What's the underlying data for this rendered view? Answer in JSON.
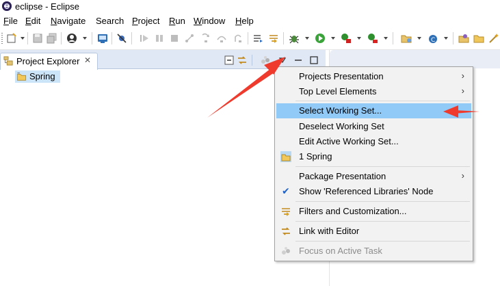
{
  "window": {
    "title": "eclipse - Eclipse"
  },
  "menubar": {
    "items": [
      {
        "label": "File",
        "mnemonic": "F",
        "rest": "ile"
      },
      {
        "label": "Edit",
        "mnemonic": "E",
        "rest": "dit"
      },
      {
        "label": "Navigate",
        "mnemonic": "N",
        "rest": "avigate"
      },
      {
        "label": "Search",
        "mnemonic": "",
        "rest": "Search"
      },
      {
        "label": "Project",
        "mnemonic": "P",
        "rest": "roject"
      },
      {
        "label": "Run",
        "mnemonic": "R",
        "rest": "un"
      },
      {
        "label": "Window",
        "mnemonic": "W",
        "rest": "indow"
      },
      {
        "label": "Help",
        "mnemonic": "H",
        "rest": "elp"
      }
    ]
  },
  "view": {
    "tab_label": "Project Explorer",
    "tab_close": "✕",
    "tree": [
      {
        "label": "Spring",
        "icon": "project-folder-icon"
      }
    ]
  },
  "menu": {
    "items": [
      {
        "label": "Projects Presentation",
        "submenu": true
      },
      {
        "label": "Top Level Elements",
        "submenu": true
      },
      {
        "label": "Select Working Set...",
        "selected": true
      },
      {
        "label": "Deselect Working Set"
      },
      {
        "label": "Edit Active Working Set..."
      },
      {
        "label": "1 Spring",
        "icon": "working-set-icon"
      },
      {
        "label": "Package Presentation",
        "submenu": true
      },
      {
        "label": "Show 'Referenced Libraries' Node",
        "checked": true
      },
      {
        "label": "Filters and Customization...",
        "icon": "filter-icon"
      },
      {
        "label": "Link with Editor",
        "icon": "link-editor-icon"
      },
      {
        "label": "Focus on Active Task",
        "icon": "focus-task-icon",
        "disabled": true
      }
    ],
    "submenu_arrow": "›",
    "check_mark": "✔"
  },
  "colors": {
    "selection": "#91c9f7",
    "annotation_arrow": "#ef3b2d",
    "tab_strip": "#dfe8f4"
  }
}
